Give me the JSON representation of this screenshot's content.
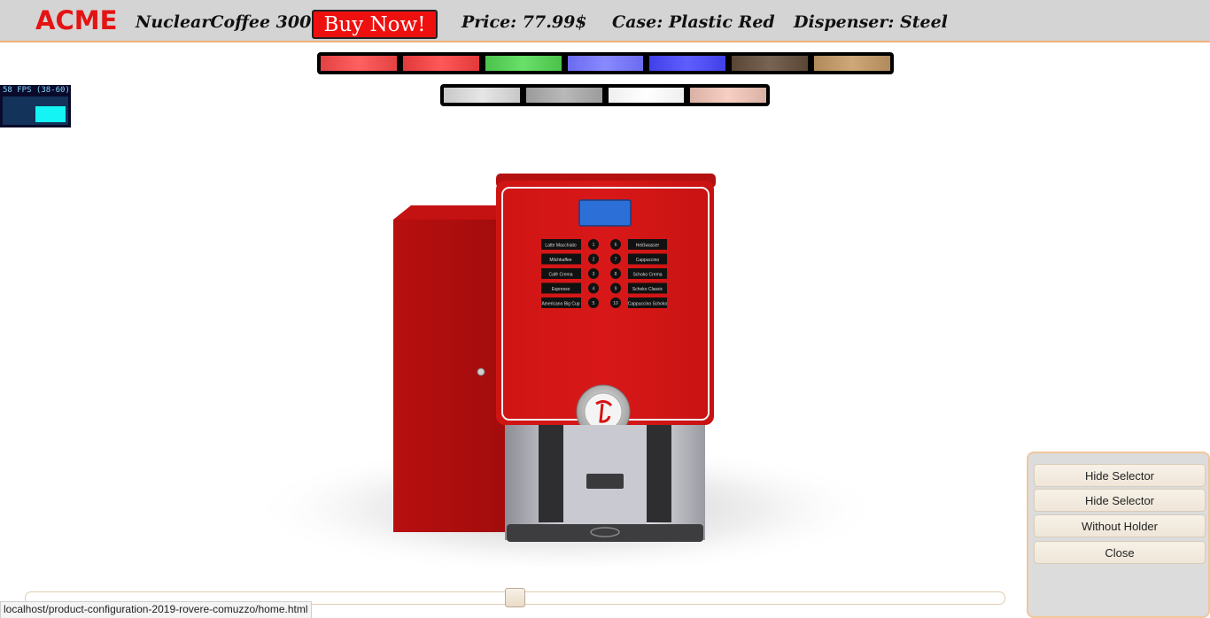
{
  "header": {
    "brand": "ACME",
    "product_name": "NuclearCoffee 3000",
    "buy_label": "Buy Now!",
    "price": "Price: 77.99$",
    "case": "Case: Plastic Red",
    "dispenser": "Dispenser: Steel"
  },
  "case_swatches": [
    {
      "name": "red-light",
      "color": "#e44242"
    },
    {
      "name": "red",
      "color": "#e23a3a"
    },
    {
      "name": "green",
      "color": "#4bc24b"
    },
    {
      "name": "blue-light",
      "color": "#6b6bf0"
    },
    {
      "name": "blue",
      "color": "#4040e8"
    },
    {
      "name": "dark-wood",
      "color": "#5a4634"
    },
    {
      "name": "light-wood",
      "color": "#b08a5a"
    }
  ],
  "dispenser_swatches": [
    {
      "name": "silver",
      "color": "#c8c8c8"
    },
    {
      "name": "gray",
      "color": "#9b9b9b"
    },
    {
      "name": "white",
      "color": "#efefef"
    },
    {
      "name": "rose",
      "color": "#d9b1a5"
    }
  ],
  "fps": {
    "label": "58 FPS (38-60)",
    "level": 0.58
  },
  "machine": {
    "display_lines": [
      "",
      "",
      ""
    ],
    "menu_left": [
      "Latte Macchiato",
      "Milchkaffee",
      "Café Crema",
      "Espresso",
      "Americano Big Cup"
    ],
    "menu_numbers_left": [
      "1",
      "2",
      "3",
      "4",
      "5"
    ],
    "menu_numbers_right": [
      "6",
      "7",
      "8",
      "9",
      "10"
    ],
    "menu_right": [
      "Heißwasser",
      "Cappuccino",
      "Schoko Crema",
      "Schoko Classic",
      "Cappuccino Schoko"
    ]
  },
  "panel": {
    "buttons": [
      "Hide Selector",
      "Hide Selector",
      "Without Holder",
      "Close"
    ]
  },
  "slider": {
    "value": 0.5
  },
  "status_url": "localhost/product-configuration-2019-rovere-comuzzo/home.html",
  "colors": {
    "header_bg": "#d4d4d4",
    "brand": "#e41414",
    "buy_button": "#ee0f0f",
    "case_red": "#d31515",
    "panel_bg": "#dcdcdc",
    "panel_border": "#f1c79a"
  }
}
